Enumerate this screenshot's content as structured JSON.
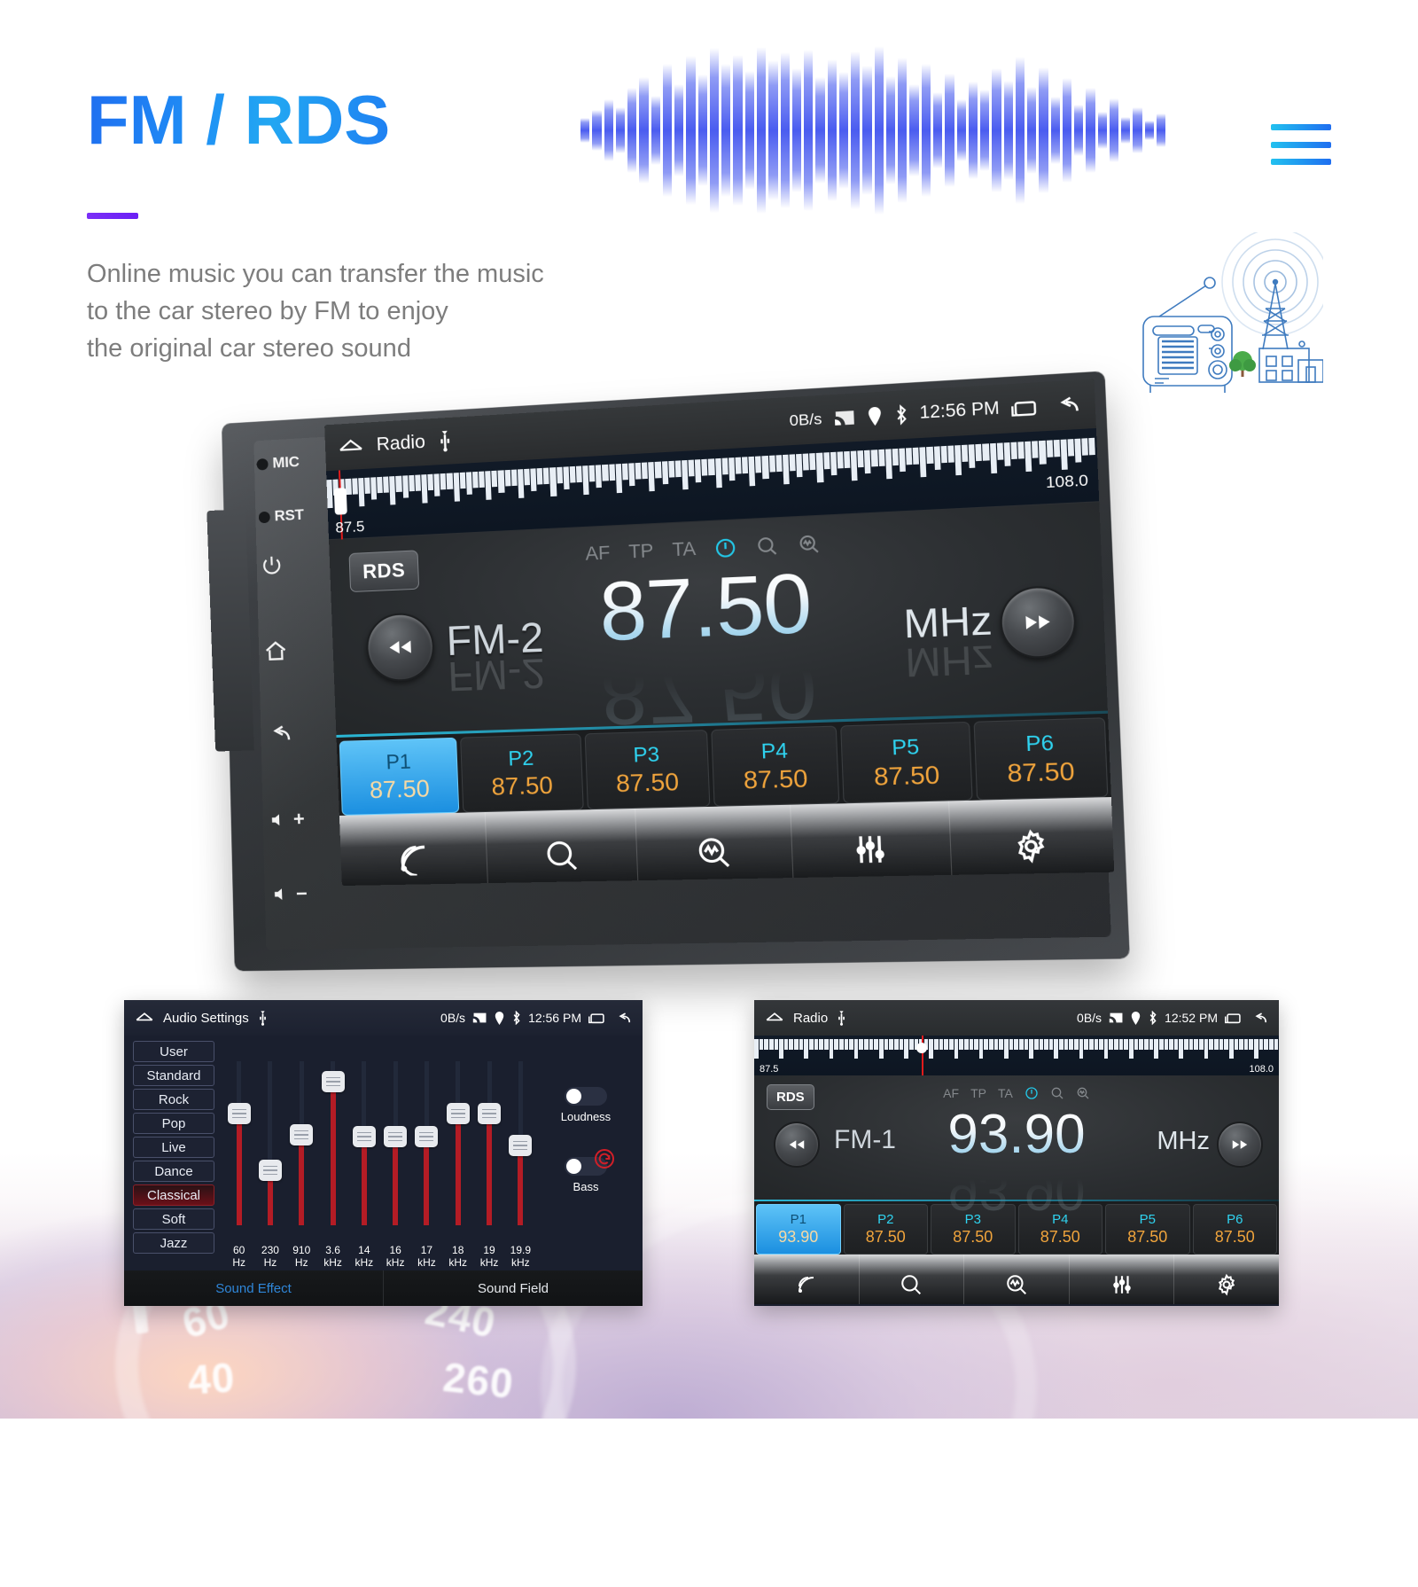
{
  "hero": {
    "title": "FM / RDS",
    "subtitle": "Online music you can transfer the music\nto the car stereo by FM to enjoy\nthe original car stereo sound",
    "menu_icon": "hamburger-menu-icon",
    "waveform_icon": "audio-waveform-icon",
    "illustration_icon": "radio-tower-illustration",
    "accent_blue": "#1f8df5",
    "accent_purple": "#6a1ff5"
  },
  "device": {
    "side_buttons": [
      {
        "label": "MIC",
        "icon": "mic-dot-icon"
      },
      {
        "label": "RST",
        "icon": "reset-dot-icon"
      },
      {
        "label": "",
        "icon": "power-icon"
      },
      {
        "label": "",
        "icon": "home-icon"
      },
      {
        "label": "",
        "icon": "back-icon"
      },
      {
        "label": "+",
        "icon": "volume-up-icon"
      },
      {
        "label": "−",
        "icon": "volume-down-icon"
      }
    ]
  },
  "main_screen": {
    "status": {
      "home_icon": "home-icon",
      "title": "Radio",
      "usb_icon": "usb-icon",
      "data_rate": "0B/s",
      "cast_icon": "cast-icon",
      "location_icon": "location-pin-icon",
      "bluetooth_icon": "bluetooth-icon",
      "time": "12:56 PM",
      "recents_icon": "recents-icon",
      "back_icon": "back-arrow-icon"
    },
    "tuner": {
      "min_label": "87.5",
      "max_label": "108.0",
      "marker_percent": 1.0
    },
    "rds_button": "RDS",
    "rds_flags": [
      "AF",
      "TP",
      "TA"
    ],
    "rds_icons": [
      "power-circle-icon",
      "search-icon",
      "scan-search-icon"
    ],
    "band": "FM-2",
    "frequency": "87.50",
    "unit": "MHz",
    "prev_icon": "rewind-icon",
    "next_icon": "fast-forward-icon",
    "presets": [
      {
        "name": "P1",
        "freq": "87.50",
        "active": true
      },
      {
        "name": "P2",
        "freq": "87.50",
        "active": false
      },
      {
        "name": "P3",
        "freq": "87.50",
        "active": false
      },
      {
        "name": "P4",
        "freq": "87.50",
        "active": false
      },
      {
        "name": "P5",
        "freq": "87.50",
        "active": false
      },
      {
        "name": "P6",
        "freq": "87.50",
        "active": false
      }
    ],
    "toolbar": [
      {
        "icon": "signal-waves-icon"
      },
      {
        "icon": "search-icon"
      },
      {
        "icon": "scan-search-icon"
      },
      {
        "icon": "equalizer-icon"
      },
      {
        "icon": "settings-gear-icon"
      }
    ]
  },
  "audio_panel": {
    "status": {
      "home_icon": "home-icon",
      "title": "Audio Settings",
      "usb_icon": "usb-icon",
      "data_rate": "0B/s",
      "cast_icon": "cast-icon",
      "location_icon": "location-pin-icon",
      "bluetooth_icon": "bluetooth-icon",
      "time": "12:56 PM",
      "recents_icon": "recents-icon",
      "back_icon": "back-arrow-icon"
    },
    "eq_presets": [
      {
        "label": "User",
        "active": false
      },
      {
        "label": "Standard",
        "active": false
      },
      {
        "label": "Rock",
        "active": false
      },
      {
        "label": "Pop",
        "active": false
      },
      {
        "label": "Live",
        "active": false
      },
      {
        "label": "Dance",
        "active": false
      },
      {
        "label": "Classical",
        "active": true
      },
      {
        "label": "Soft",
        "active": false
      },
      {
        "label": "Jazz",
        "active": false
      }
    ],
    "bands": [
      {
        "freq": "60",
        "unit": "Hz",
        "value": 62
      },
      {
        "freq": "230",
        "unit": "Hz",
        "value": 30
      },
      {
        "freq": "910",
        "unit": "Hz",
        "value": 50
      },
      {
        "freq": "3.6",
        "unit": "kHz",
        "value": 80
      },
      {
        "freq": "14",
        "unit": "kHz",
        "value": 49
      },
      {
        "freq": "16",
        "unit": "kHz",
        "value": 49
      },
      {
        "freq": "17",
        "unit": "kHz",
        "value": 49
      },
      {
        "freq": "18",
        "unit": "kHz",
        "value": 62
      },
      {
        "freq": "19",
        "unit": "kHz",
        "value": 62
      },
      {
        "freq": "19.9",
        "unit": "kHz",
        "value": 44
      }
    ],
    "toggles": [
      {
        "label": "Loudness",
        "on": false
      },
      {
        "label": "Bass",
        "on": false
      }
    ],
    "reset_icon": "reset-circle-icon",
    "tabs": [
      {
        "label": "Sound Effect",
        "active": true
      },
      {
        "label": "Sound Field",
        "active": false
      }
    ]
  },
  "radio_panel": {
    "status": {
      "home_icon": "home-icon",
      "title": "Radio",
      "usb_icon": "usb-icon",
      "data_rate": "0B/s",
      "cast_icon": "cast-icon",
      "location_icon": "location-pin-icon",
      "bluetooth_icon": "bluetooth-icon",
      "time": "12:52 PM",
      "recents_icon": "recents-icon",
      "back_icon": "back-arrow-icon"
    },
    "tuner": {
      "min_label": "87.5",
      "max_label": "108.0",
      "marker_percent": 32
    },
    "rds_button": "RDS",
    "rds_flags": [
      "AF",
      "TP",
      "TA"
    ],
    "band": "FM-1",
    "frequency": "93.90",
    "unit": "MHz",
    "presets": [
      {
        "name": "P1",
        "freq": "93.90",
        "active": true
      },
      {
        "name": "P2",
        "freq": "87.50",
        "active": false
      },
      {
        "name": "P3",
        "freq": "87.50",
        "active": false
      },
      {
        "name": "P4",
        "freq": "87.50",
        "active": false
      },
      {
        "name": "P5",
        "freq": "87.50",
        "active": false
      },
      {
        "name": "P6",
        "freq": "87.50",
        "active": false
      }
    ],
    "toolbar": [
      {
        "icon": "signal-waves-icon"
      },
      {
        "icon": "search-icon"
      },
      {
        "icon": "scan-search-icon"
      },
      {
        "icon": "equalizer-icon"
      },
      {
        "icon": "settings-gear-icon"
      }
    ]
  },
  "background": {
    "gauge_numbers": [
      "60",
      "40",
      "240",
      "260"
    ]
  }
}
